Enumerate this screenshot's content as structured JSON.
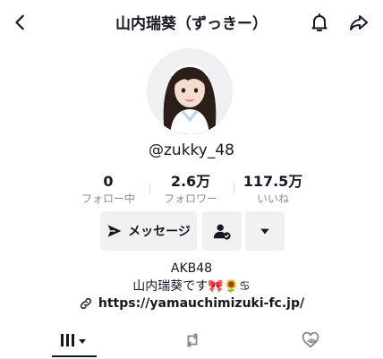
{
  "header": {
    "title": "山内瑞葵（ずっきー）",
    "back_icon": "chevron-left-icon",
    "bell_icon": "bell-icon",
    "share_icon": "share-arrow-icon"
  },
  "profile": {
    "username": "@zukky_48"
  },
  "stats": [
    {
      "value": "0",
      "label": "フォロー中"
    },
    {
      "value": "2.6万",
      "label": "フォロワー"
    },
    {
      "value": "117.5万",
      "label": "いいね"
    }
  ],
  "actions": {
    "message_label": "メッセージ",
    "message_icon": "send-icon",
    "follow_icon": "user-check-icon",
    "more_icon": "caret-down-icon"
  },
  "bio": {
    "line1": "AKB48",
    "line2": "山内瑞葵です🎀🌻♋"
  },
  "website": {
    "url": "https://yamauchimizuki-fc.jp/",
    "icon": "link-icon"
  },
  "tabs": [
    {
      "icon": "grid-icon",
      "active": true
    },
    {
      "icon": "repost-icon",
      "active": false
    },
    {
      "icon": "liked-hidden-icon",
      "active": false
    }
  ]
}
